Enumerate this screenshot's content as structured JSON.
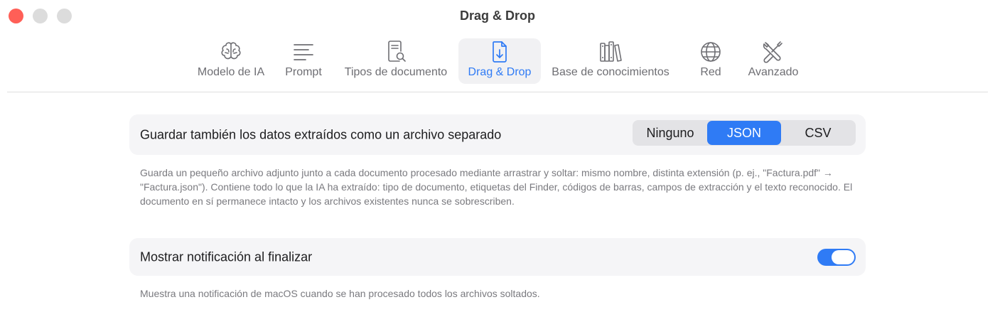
{
  "window": {
    "title": "Drag & Drop"
  },
  "toolbar": {
    "tabs": [
      {
        "label": "Modelo de IA",
        "icon": "brain-icon",
        "active": false
      },
      {
        "label": "Prompt",
        "icon": "text-lines-icon",
        "active": false
      },
      {
        "label": "Tipos de documento",
        "icon": "document-search-icon",
        "active": false
      },
      {
        "label": "Drag & Drop",
        "icon": "document-download-icon",
        "active": true
      },
      {
        "label": "Base de conocimientos",
        "icon": "books-icon",
        "active": false
      },
      {
        "label": "Red",
        "icon": "globe-icon",
        "active": false
      },
      {
        "label": "Avanzado",
        "icon": "tools-icon",
        "active": false
      }
    ]
  },
  "settings": {
    "export": {
      "label": "Guardar también los datos extraídos como un archivo separado",
      "options": [
        "Ninguno",
        "JSON",
        "CSV"
      ],
      "selected": "JSON",
      "description": "Guarda un pequeño archivo adjunto junto a cada documento procesado mediante arrastrar y soltar: mismo nombre, distinta extensión (p. ej., \"Factura.pdf\" → \"Factura.json\"). Contiene todo lo que la IA ha extraído: tipo de documento, etiquetas del Finder, códigos de barras, campos de extracción y el texto reconocido. El documento en sí permanece intacto y los archivos existentes nunca se sobrescriben."
    },
    "notification": {
      "label": "Mostrar notificación al finalizar",
      "enabled": true,
      "description": "Muestra una notificación de macOS cuando se han procesado todos los archivos soltados."
    }
  },
  "colors": {
    "accent": "#2f7bf5",
    "close": "#ff5f57",
    "row_background": "#f5f5f7"
  }
}
